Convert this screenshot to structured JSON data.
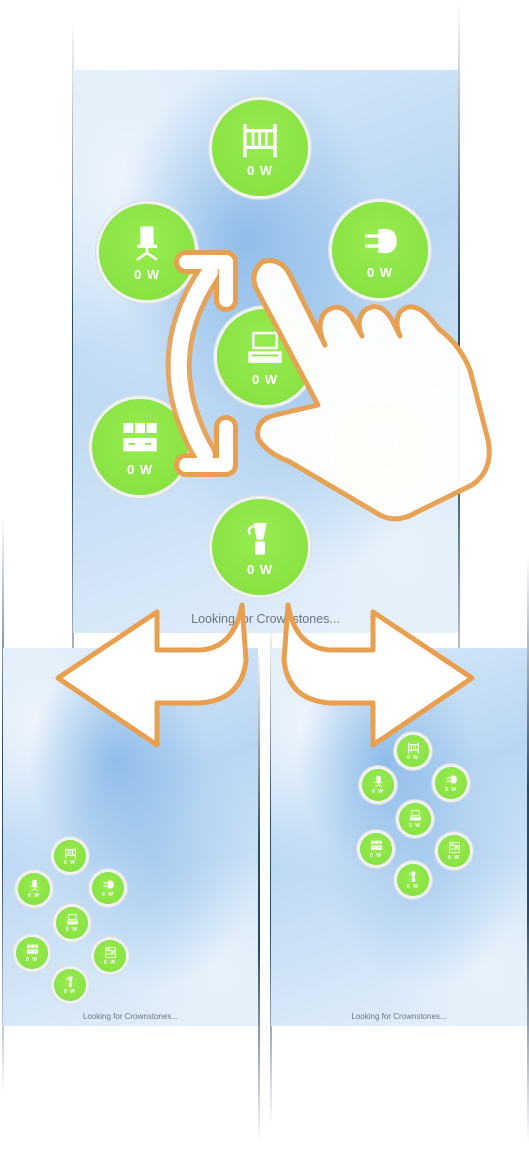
{
  "status_text": "Looking for Crownstones...",
  "colors": {
    "bubble": "#86e040",
    "arrow_outline": "#e8a050",
    "arrow_fill": "#ffffff"
  },
  "devices": [
    {
      "icon": "crib-icon",
      "power": "0 W"
    },
    {
      "icon": "office-chair-icon",
      "power": "0 W"
    },
    {
      "icon": "plug-icon",
      "power": "0 W"
    },
    {
      "icon": "tv-stand-icon",
      "power": "0 W"
    },
    {
      "icon": "cabinet-icon",
      "power": "0 W"
    },
    {
      "icon": "shelves-icon",
      "power": "0 W"
    },
    {
      "icon": "blender-icon",
      "power": "0 W"
    }
  ],
  "gestures": [
    {
      "icon": "hand-swipe-icon"
    },
    {
      "icon": "rotate-arrow-icon"
    },
    {
      "icon": "arrow-left-icon"
    },
    {
      "icon": "arrow-right-icon"
    }
  ]
}
